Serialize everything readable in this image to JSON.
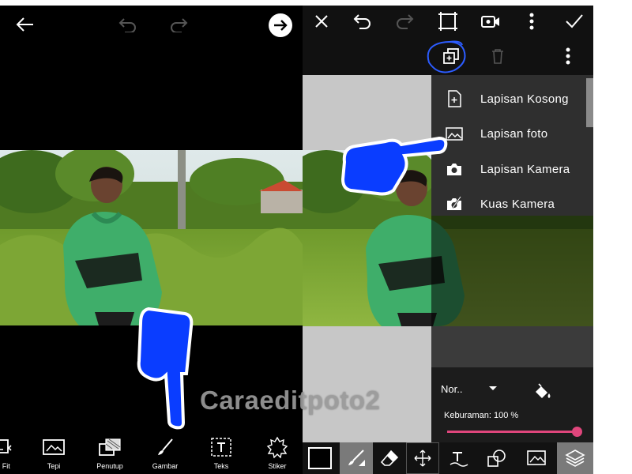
{
  "left_screen": {
    "topbar": {
      "back_icon": "arrow-left-icon",
      "undo_icon": "undo-icon",
      "redo_icon": "redo-icon",
      "next_icon": "arrow-right-circle-icon"
    },
    "tools": [
      {
        "label": "e Fit",
        "icon": "fit-icon"
      },
      {
        "label": "Tepi",
        "icon": "border-icon"
      },
      {
        "label": "Penutup",
        "icon": "mask-icon"
      },
      {
        "label": "Gambar",
        "icon": "brush-icon"
      },
      {
        "label": "Teks",
        "icon": "text-icon"
      },
      {
        "label": "Stiker",
        "icon": "sticker-icon"
      }
    ]
  },
  "watermark": "Caraeditpoto2",
  "right_screen": {
    "topbar": {
      "close_icon": "close-icon",
      "undo_icon": "undo-icon",
      "redo_icon": "redo-icon",
      "crop_icon": "crop-frame-icon",
      "video_icon": "video-camera-icon",
      "more_icon": "more-vertical-icon",
      "apply_icon": "check-icon"
    },
    "layer_menu": [
      {
        "label": "Lapisan Kosong",
        "icon": "blank-layer-icon"
      },
      {
        "label": "Lapisan foto",
        "icon": "photo-layer-icon"
      },
      {
        "label": "Lapisan Kamera",
        "icon": "camera-icon"
      },
      {
        "label": "Kuas Kamera",
        "icon": "camera-brush-icon"
      }
    ],
    "panel": {
      "blend_mode": "Nor..",
      "opacity_label": "Keburaman: 100 %",
      "opacity_value": 100
    },
    "colors": {
      "accent": "#e0467c",
      "pointer_hand": "#0a3dff",
      "highlight_circle": "#2c5cff"
    }
  }
}
